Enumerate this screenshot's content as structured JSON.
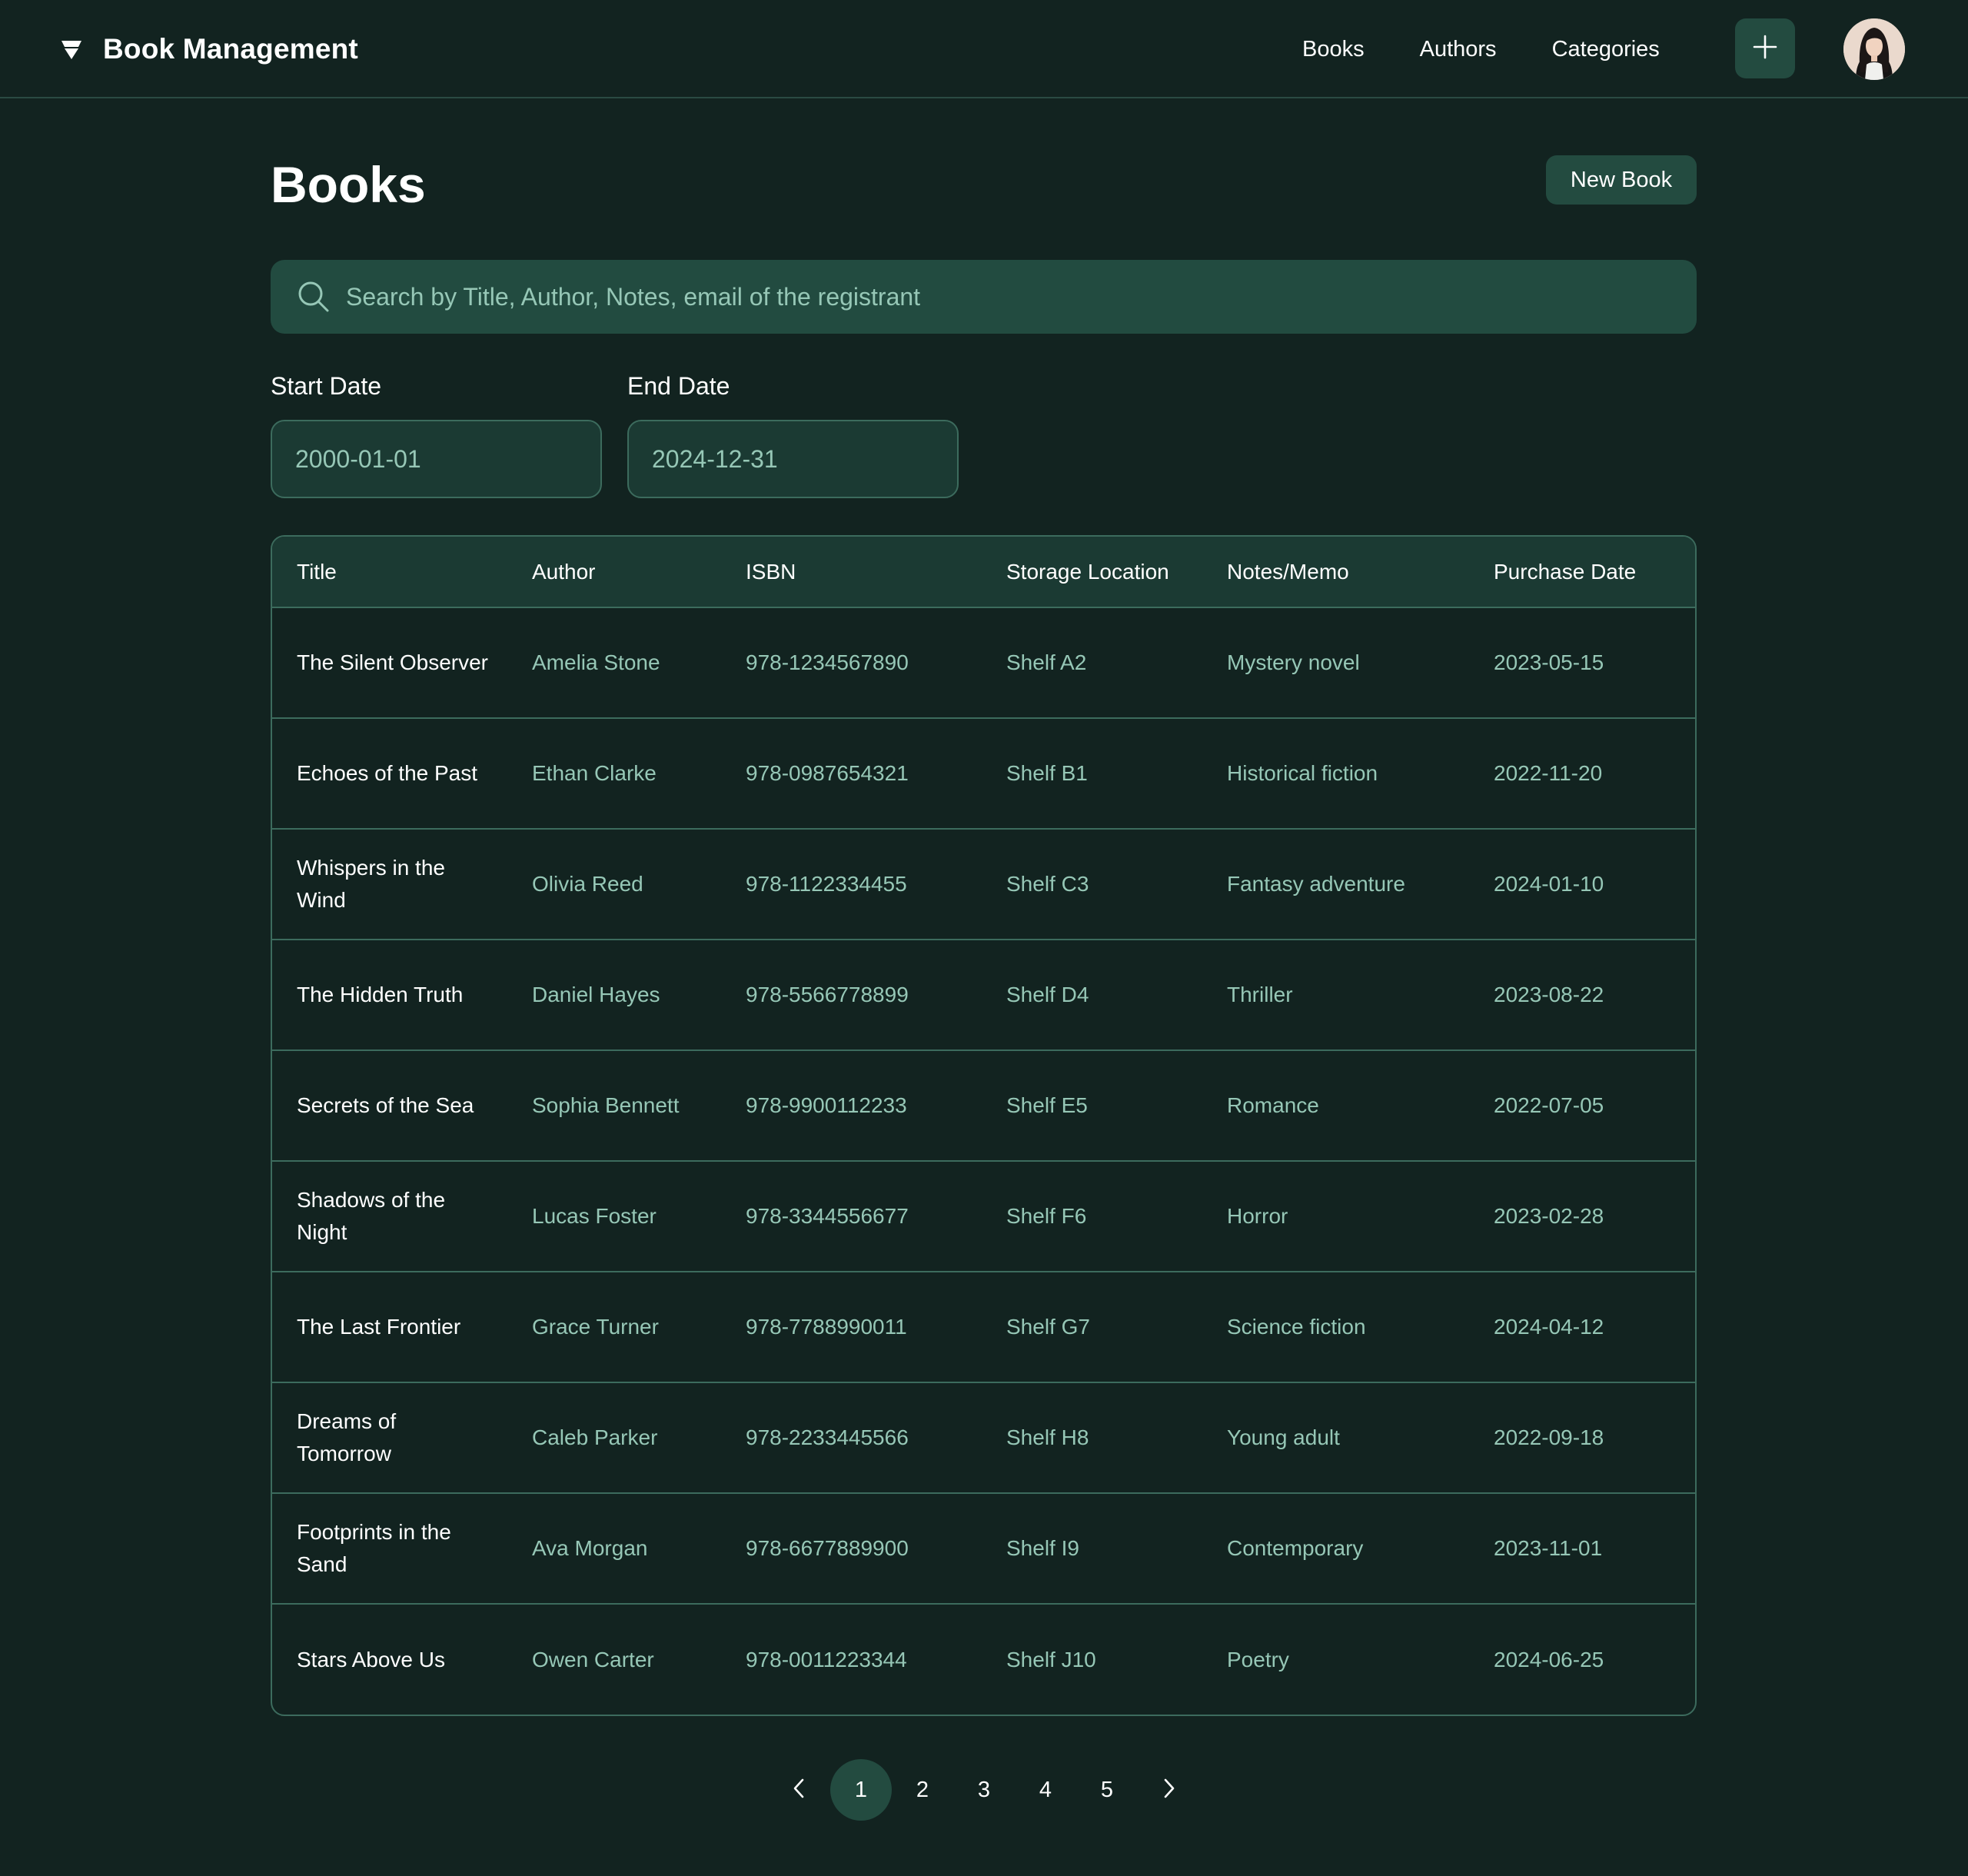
{
  "app": {
    "title": "Book Management",
    "nav": [
      {
        "label": "Books"
      },
      {
        "label": "Authors"
      },
      {
        "label": "Categories"
      }
    ]
  },
  "page": {
    "title": "Books",
    "new_button": "New Book"
  },
  "search": {
    "placeholder": "Search by Title, Author, Notes, email of the registrant",
    "value": ""
  },
  "filters": {
    "start_label": "Start Date",
    "start_value": "2000-01-01",
    "end_label": "End Date",
    "end_value": "2024-12-31"
  },
  "table": {
    "columns": [
      "Title",
      "Author",
      "ISBN",
      "Storage Location",
      "Notes/Memo",
      "Purchase Date"
    ],
    "rows": [
      {
        "title": "The Silent Observer",
        "author": "Amelia Stone",
        "isbn": "978-1234567890",
        "location": "Shelf A2",
        "notes": "Mystery novel",
        "date": "2023-05-15"
      },
      {
        "title": "Echoes of the Past",
        "author": "Ethan Clarke",
        "isbn": "978-0987654321",
        "location": "Shelf B1",
        "notes": "Historical fiction",
        "date": "2022-11-20"
      },
      {
        "title": "Whispers in the Wind",
        "author": "Olivia Reed",
        "isbn": "978-1122334455",
        "location": "Shelf C3",
        "notes": "Fantasy adventure",
        "date": "2024-01-10"
      },
      {
        "title": "The Hidden Truth",
        "author": "Daniel Hayes",
        "isbn": "978-5566778899",
        "location": "Shelf D4",
        "notes": "Thriller",
        "date": "2023-08-22"
      },
      {
        "title": "Secrets of the Sea",
        "author": "Sophia Bennett",
        "isbn": "978-9900112233",
        "location": "Shelf E5",
        "notes": "Romance",
        "date": "2022-07-05"
      },
      {
        "title": "Shadows of the Night",
        "author": "Lucas Foster",
        "isbn": "978-3344556677",
        "location": "Shelf F6",
        "notes": "Horror",
        "date": "2023-02-28"
      },
      {
        "title": "The Last Frontier",
        "author": "Grace Turner",
        "isbn": "978-7788990011",
        "location": "Shelf G7",
        "notes": "Science fiction",
        "date": "2024-04-12"
      },
      {
        "title": "Dreams of Tomorrow",
        "author": "Caleb Parker",
        "isbn": "978-2233445566",
        "location": "Shelf H8",
        "notes": "Young adult",
        "date": "2022-09-18"
      },
      {
        "title": "Footprints in the Sand",
        "author": "Ava Morgan",
        "isbn": "978-6677889900",
        "location": "Shelf I9",
        "notes": "Contemporary",
        "date": "2023-11-01"
      },
      {
        "title": "Stars Above Us",
        "author": "Owen Carter",
        "isbn": "978-0011223344",
        "location": "Shelf J10",
        "notes": "Poetry",
        "date": "2024-06-25"
      }
    ]
  },
  "pagination": {
    "pages": [
      "1",
      "2",
      "3",
      "4",
      "5"
    ],
    "current": "1"
  },
  "icons": {
    "logo": "logo-icon",
    "add": "plus-icon",
    "search": "search-icon",
    "prev": "chevron-left-icon",
    "next": "chevron-right-icon"
  },
  "colors": {
    "background": "#122320",
    "accent": "#234b40",
    "muted_text": "#96c7b6",
    "border": "#3c6b5d"
  }
}
